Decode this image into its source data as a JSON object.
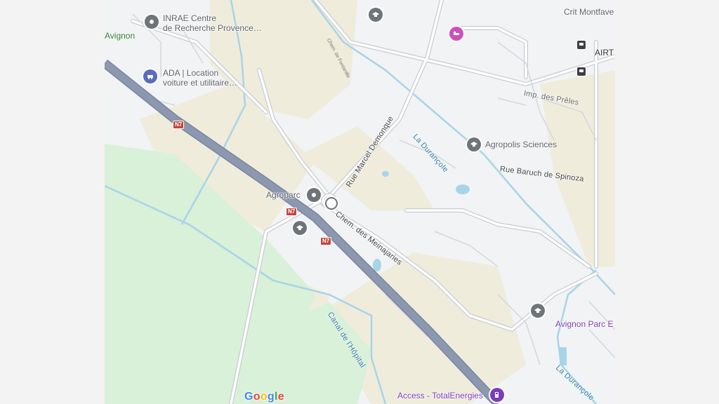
{
  "places": {
    "inrae_line1": "INRAE Centre",
    "inrae_line2": "de Recherche Provence…",
    "ada_line1": "ADA | Location",
    "ada_line2": "voiture et utilitaire…",
    "agroparc": "Agroparc",
    "agropolis": "Agropolis Sciences",
    "avignon_parc": "Avignon Parc E",
    "access_total": "Access - TotalEnergies",
    "crit": "Crit Montfave",
    "airt": "AIRT",
    "avignon": "Avignon"
  },
  "roads": {
    "marcel": "Rue Marcel Demonque",
    "meinajaries": "Chem. des Meinajaries",
    "baruch": "Rue Baruch de Spinoza",
    "preles": "Imp. des Prêles",
    "fontanille": "Chem. de Fontanille",
    "route_n7_a": "N7",
    "route_n7_b": "N7",
    "route_n7_c": "N7"
  },
  "waterways": {
    "durancole_1": "La Durançole",
    "durancole_2": "La Durançole",
    "canal": "Canal de l'Hôpital"
  },
  "logo": {
    "letters": [
      "G",
      "o",
      "o",
      "g",
      "l",
      "e"
    ],
    "colors": [
      "#4285F4",
      "#EA4335",
      "#FBBC05",
      "#4285F4",
      "#34A853",
      "#EA4335"
    ]
  },
  "colors": {
    "land": "#f1f3f4",
    "park": "#d9f0d9",
    "zone": "#efecdc",
    "highway": "#8c97b0",
    "water": "#a8d4e8",
    "road": "#ffffff",
    "road_outline": "#c8ccd2"
  },
  "icons": [
    "education-icon",
    "place-icon",
    "car-rental-icon",
    "hotel-icon",
    "fuel-icon",
    "transit-icon",
    "roundabout-icon"
  ]
}
